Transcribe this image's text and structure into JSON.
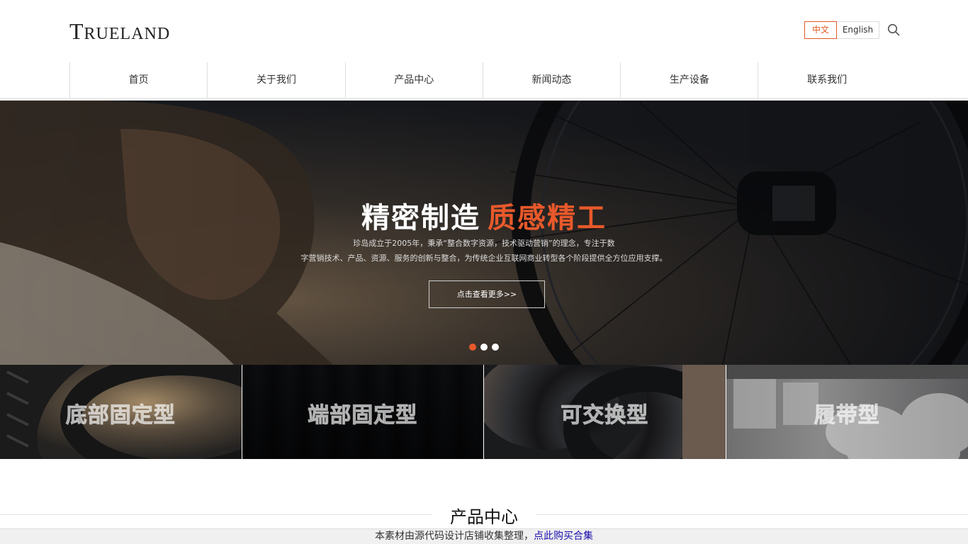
{
  "header": {
    "logo_initial": "T",
    "logo_rest": "RUELAND",
    "lang_zh": "中文",
    "lang_en": "English",
    "accent_color": "#e35b26"
  },
  "nav": {
    "items": [
      "首页",
      "关于我们",
      "产品中心",
      "新闻动态",
      "生产设备",
      "联系我们"
    ],
    "active_index": 0
  },
  "hero": {
    "title_main": "精密制造",
    "title_accent": "质感精工",
    "desc_line1": "珍岛成立于2005年，秉承“整合数字资源，技术驱动营销”的理念，专注于数",
    "desc_line2": "字营销技术、产品、资源、服务的创新与整合，为传统企业互联网商业转型各个阶段提供全方位应用支撑。",
    "button": "点击查看更多>>",
    "slide_count": 3,
    "active_slide": 0
  },
  "categories": [
    "底部固定型",
    "端部固定型",
    "可交换型",
    "履带型"
  ],
  "section": {
    "title": "产品中心"
  },
  "notice": {
    "text": "本素材由源代码设计店铺收集整理，",
    "link": "点此购买合集"
  }
}
